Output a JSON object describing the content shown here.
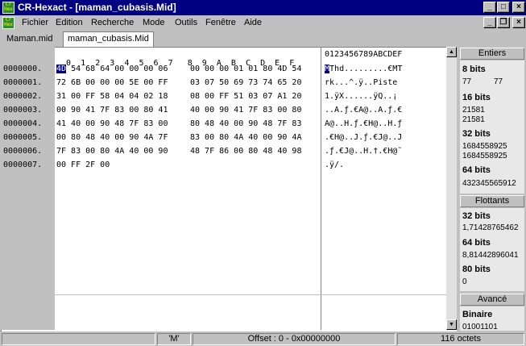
{
  "window": {
    "title": "CR-Hexact - [maman_cubasis.Mid]",
    "app_icon_text": "Cr Hex"
  },
  "menu": {
    "icon_text": "Cr Hex",
    "items": [
      "Fichier",
      "Edition",
      "Recherche",
      "Mode",
      "Outils",
      "Fenêtre",
      "Aide"
    ]
  },
  "tabs": [
    "Maman.mid",
    "maman_cubasis.Mid"
  ],
  "hex": {
    "header_cols": [
      "0",
      "1",
      "2",
      "3",
      "4",
      "5",
      "6",
      "7",
      "8",
      "9",
      "A",
      "B",
      "C",
      "D",
      "E",
      "F"
    ],
    "ascii_header": "0123456789ABCDEF",
    "rows": [
      {
        "addr": "0000000.",
        "a": "4D 54 68 64 00 00 00 06",
        "b": "00 00 00 01 01 80 4D 54",
        "ascii": "MThd.........€MT"
      },
      {
        "addr": "0000001.",
        "a": "72 6B 00 00 00 5E 00 FF",
        "b": "03 07 50 69 73 74 65 20",
        "ascii": "rk...^.ÿ..Piste "
      },
      {
        "addr": "0000002.",
        "a": "31 00 FF 58 04 04 02 18",
        "b": "08 00 FF 51 03 07 A1 20",
        "ascii": "1.ÿX......ÿQ..¡ "
      },
      {
        "addr": "0000003.",
        "a": "00 90 41 7F 83 00 80 41",
        "b": "40 00 90 41 7F 83 00 80",
        "ascii": "..A.ƒ.€A@..A.ƒ.€"
      },
      {
        "addr": "0000004.",
        "a": "41 40 00 90 48 7F 83 00",
        "b": "80 48 40 00 90 48 7F 83",
        "ascii": "A@..H.ƒ.€H@..H.ƒ"
      },
      {
        "addr": "0000005.",
        "a": "00 80 48 40 00 90 4A 7F",
        "b": "83 00 80 4A 40 00 90 4A",
        "ascii": ".€H@..J.ƒ.€J@..J"
      },
      {
        "addr": "0000006.",
        "a": "7F 83 00 80 4A 40 00 90",
        "b": "48 7F 86 00 80 48 40 98",
        "ascii": ".ƒ.€J@..H.†.€H@˜"
      },
      {
        "addr": "0000007.",
        "a": "00 FF 2F 00",
        "b": "",
        "ascii": ".ÿ/."
      }
    ],
    "selected_hex": "4D",
    "selected_ascii": "M"
  },
  "panel": {
    "entiers_header": "Entiers",
    "bits8_label": "8 bits",
    "bits8_a": "77",
    "bits8_b": "77",
    "bits16_label": "16 bits",
    "bits16_a": "21581",
    "bits16_b": "21581",
    "bits32_label": "32 bits",
    "bits32_a": "1684558925",
    "bits32_b": "1684558925",
    "bits64_label": "64 bits",
    "bits64_a": "432345565912",
    "flottants_header": "Flottants",
    "f32_label": "32 bits",
    "f32_val": "1,71428765462",
    "f64_label": "64 bits",
    "f64_val": "8,81442896041",
    "f80_label": "80 bits",
    "f80_val": "0",
    "avance_header": "Avancé",
    "binaire_label": "Binaire",
    "binaire_val": "01001101"
  },
  "status": {
    "mode": "'M'",
    "offset": "Offset : 0  -  0x00000000",
    "size": "116 octets"
  }
}
